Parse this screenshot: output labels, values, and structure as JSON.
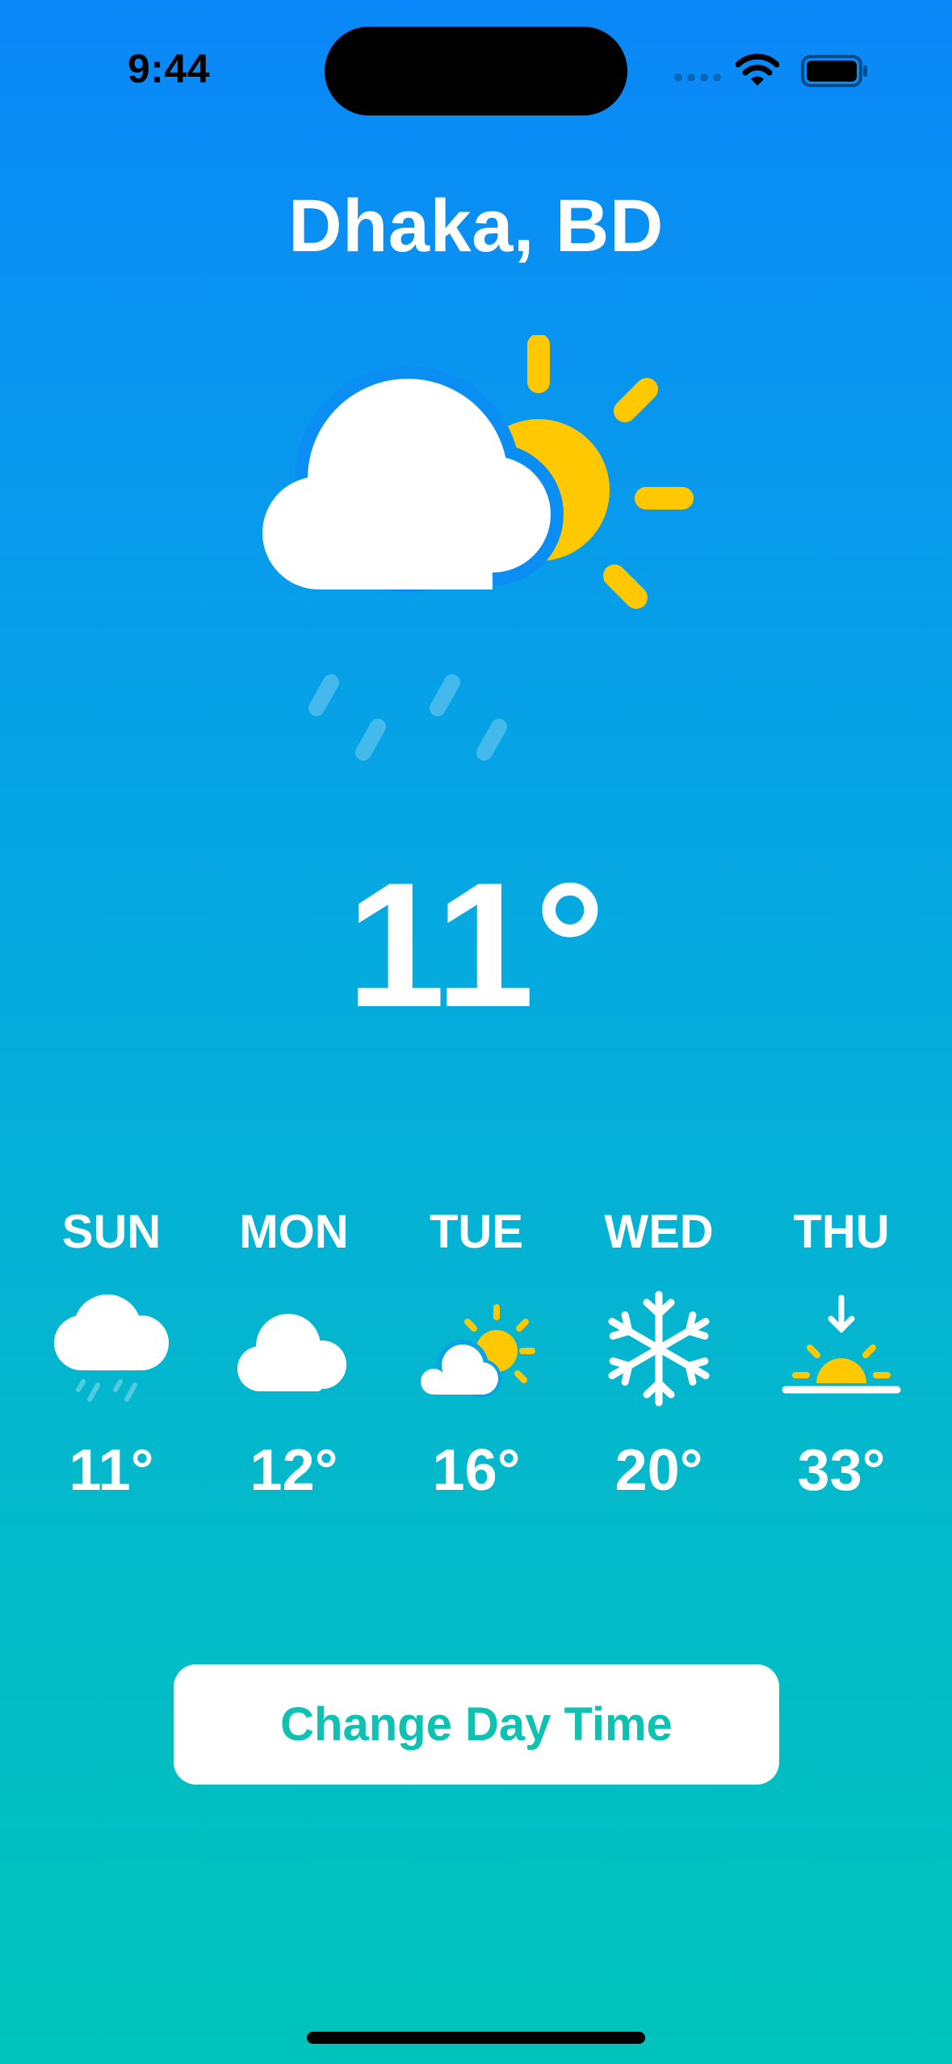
{
  "status_bar": {
    "time": "9:44",
    "icons": [
      "signal-icon",
      "wifi-icon",
      "battery-icon"
    ]
  },
  "location": {
    "city": "Dhaka, BD"
  },
  "current": {
    "condition_icon": "cloud-sun-rain-icon",
    "temperature": "11°"
  },
  "forecast": [
    {
      "day": "SUN",
      "icon": "cloud-rain-icon",
      "temperature": "11°"
    },
    {
      "day": "MON",
      "icon": "cloud-icon",
      "temperature": "12°"
    },
    {
      "day": "TUE",
      "icon": "cloud-sun-icon",
      "temperature": "16°"
    },
    {
      "day": "WED",
      "icon": "snowflake-icon",
      "temperature": "20°"
    },
    {
      "day": "THU",
      "icon": "sunset-icon",
      "temperature": "33°"
    }
  ],
  "actions": {
    "change_day_time_label": "Change Day Time"
  },
  "colors": {
    "background_top": "#0a87f8",
    "background_bottom": "#00c3bb",
    "sun": "#ffc800",
    "button_text": "#0ec1b0"
  }
}
